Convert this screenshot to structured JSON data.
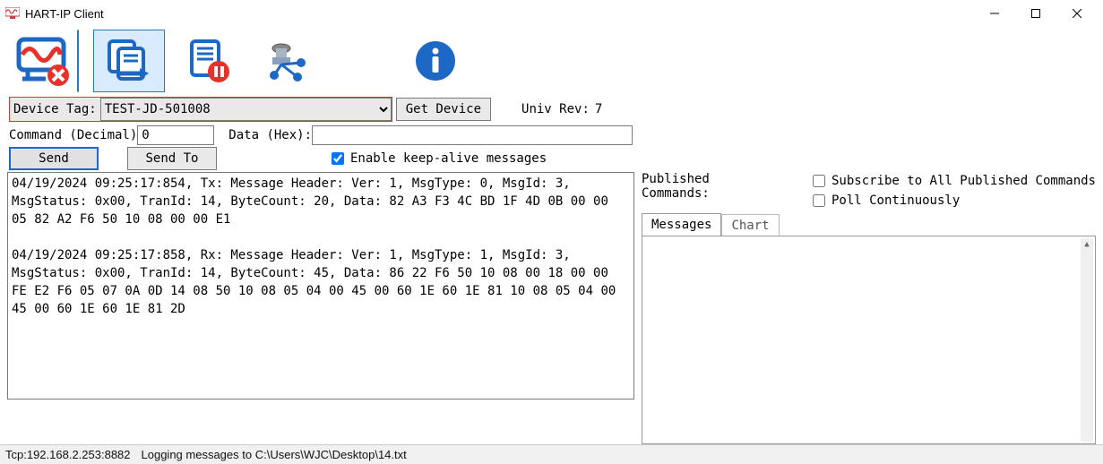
{
  "window": {
    "title": "HART-IP Client"
  },
  "toolbar_icons": [
    "wave-disconnect-icon",
    "copy-forward-icon",
    "doc-pause-icon",
    "molecule-icon",
    "info-icon"
  ],
  "device": {
    "tag_label": "Device Tag:",
    "tag_value": "TEST-JD-501008",
    "get_device_label": "Get Device",
    "univ_rev_label": "Univ Rev:",
    "univ_rev_value": "7"
  },
  "command": {
    "cmd_label": "Command (Decimal)",
    "cmd_value": "0",
    "data_label": "Data (Hex):",
    "data_value": ""
  },
  "actions": {
    "send_label": "Send",
    "send_to_label": "Send To",
    "keepalive_label": "Enable keep-alive messages",
    "keepalive_checked": true
  },
  "log_text": "04/19/2024 09:25:17:854, Tx: Message Header: Ver: 1, MsgType: 0, MsgId: 3, MsgStatus: 0x00, TranId: 14, ByteCount: 20, Data: 82 A3 F3 4C BD 1F 4D 0B 00 00 05 82 A2 F6 50 10 08 00 00 E1\n\n04/19/2024 09:25:17:858, Rx: Message Header: Ver: 1, MsgType: 1, MsgId: 3, MsgStatus: 0x00, TranId: 14, ByteCount: 45, Data: 86 22 F6 50 10 08 00 18 00 00 FE E2 F6 05 07 0A 0D 14 08 50 10 08 05 04 00 45 00 60 1E 60 1E 81 10 08 05 04 00 45 00 60 1E 60 1E 81 2D",
  "published": {
    "label": "Published Commands:",
    "subscribe_label": "Subscribe to All Published Commands",
    "subscribe_checked": false,
    "poll_label": "Poll Continuously",
    "poll_checked": false,
    "tabs": {
      "messages": "Messages",
      "chart": "Chart"
    }
  },
  "status": {
    "tcp": "Tcp:192.168.2.253:8882",
    "logging": "Logging messages to C:\\Users\\WJC\\Desktop\\14.txt"
  }
}
